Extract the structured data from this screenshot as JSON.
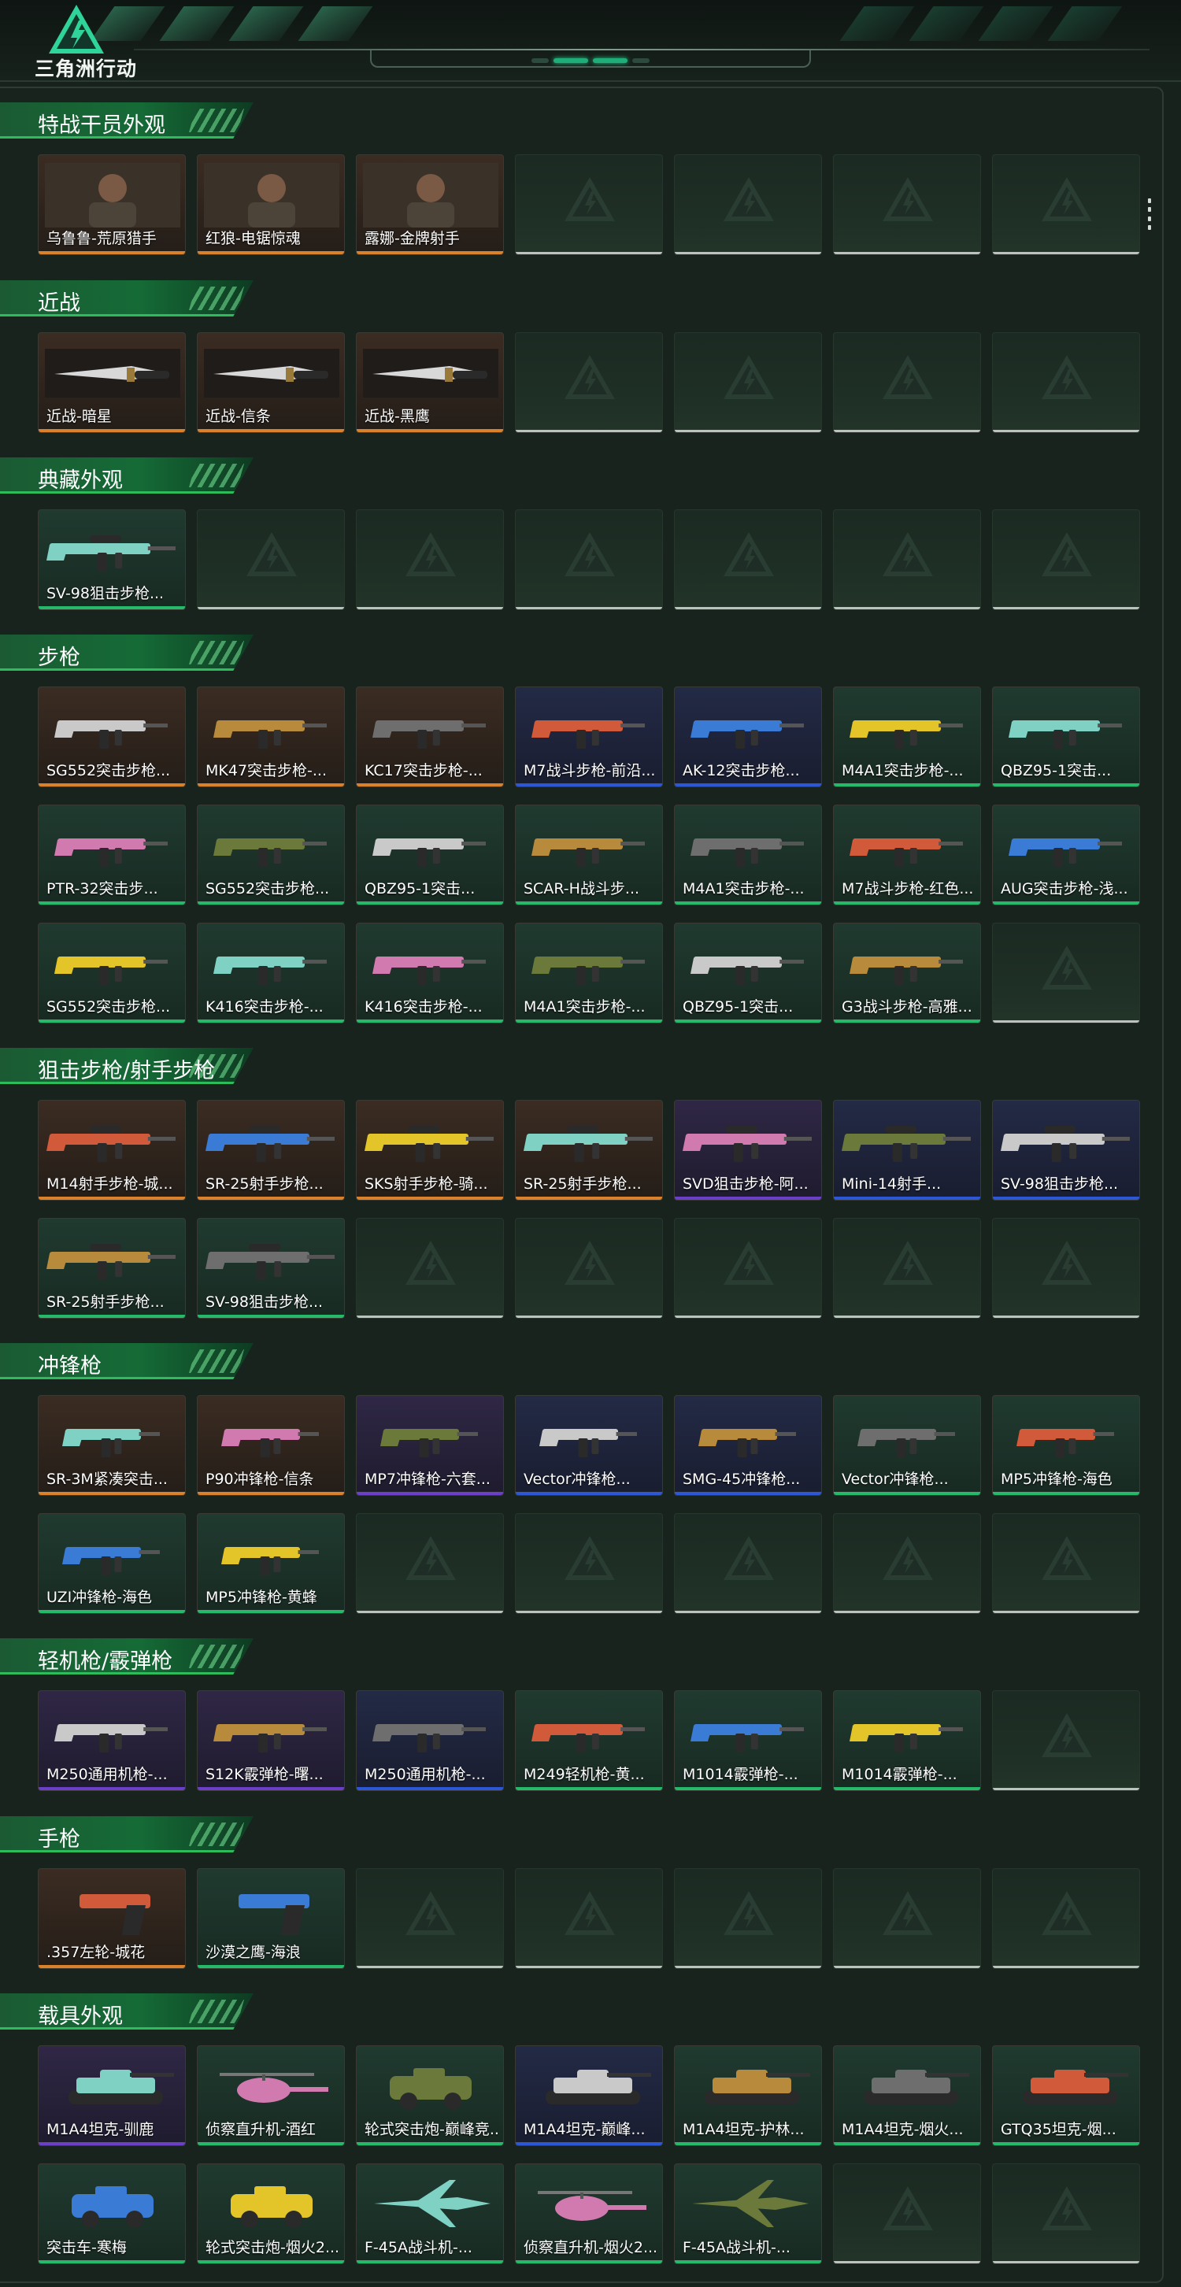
{
  "header": {
    "logo_text": "三角洲行动"
  },
  "colors": {
    "accent": "#1fae7a",
    "section_bar": "#156b36",
    "rarity": {
      "gold": "#d9822b",
      "purple": "#6b3fc8",
      "blue": "#2c58d8",
      "green": "#27b96a",
      "empty": "#bcc3bf"
    }
  },
  "sections": [
    {
      "title": "特战干员外观",
      "items": [
        {
          "name": "乌鲁鲁-荒原猎手",
          "rarity": "gold",
          "icon": "operator-portrait"
        },
        {
          "name": "红狼-电锯惊魂",
          "rarity": "gold",
          "icon": "operator-portrait"
        },
        {
          "name": "露娜-金牌射手",
          "rarity": "gold",
          "icon": "operator-portrait"
        }
      ],
      "slots": 7
    },
    {
      "title": "近战",
      "items": [
        {
          "name": "近战-暗星",
          "rarity": "gold",
          "icon": "knife"
        },
        {
          "name": "近战-信条",
          "rarity": "gold",
          "icon": "knife"
        },
        {
          "name": "近战-黑鹰",
          "rarity": "gold",
          "icon": "knife"
        }
      ],
      "slots": 7
    },
    {
      "title": "典藏外观",
      "items": [
        {
          "name": "SV-98狙击步枪...",
          "rarity": "green",
          "icon": "sniper-rifle"
        }
      ],
      "slots": 7
    },
    {
      "title": "步枪",
      "items": [
        {
          "name": "SG552突击步枪...",
          "rarity": "gold",
          "icon": "rifle"
        },
        {
          "name": "MK47突击步枪-...",
          "rarity": "gold",
          "icon": "rifle"
        },
        {
          "name": "KC17突击步枪-...",
          "rarity": "gold",
          "icon": "rifle"
        },
        {
          "name": "M7战斗步枪-前沿...",
          "rarity": "blue",
          "icon": "rifle"
        },
        {
          "name": "AK-12突击步枪...",
          "rarity": "blue",
          "icon": "rifle"
        },
        {
          "name": "M4A1突击步枪-...",
          "rarity": "green",
          "icon": "rifle"
        },
        {
          "name": "QBZ95-1突击...",
          "rarity": "green",
          "icon": "rifle"
        },
        {
          "name": "PTR-32突击步...",
          "rarity": "green",
          "icon": "rifle"
        },
        {
          "name": "SG552突击步枪...",
          "rarity": "green",
          "icon": "rifle"
        },
        {
          "name": "QBZ95-1突击...",
          "rarity": "green",
          "icon": "rifle"
        },
        {
          "name": "SCAR-H战斗步...",
          "rarity": "green",
          "icon": "rifle"
        },
        {
          "name": "M4A1突击步枪-...",
          "rarity": "green",
          "icon": "rifle"
        },
        {
          "name": "M7战斗步枪-红色...",
          "rarity": "green",
          "icon": "rifle"
        },
        {
          "name": "AUG突击步枪-浅...",
          "rarity": "green",
          "icon": "rifle"
        },
        {
          "name": "SG552突击步枪...",
          "rarity": "green",
          "icon": "rifle"
        },
        {
          "name": "K416突击步枪-...",
          "rarity": "green",
          "icon": "rifle"
        },
        {
          "name": "K416突击步枪-...",
          "rarity": "green",
          "icon": "rifle"
        },
        {
          "name": "M4A1突击步枪-...",
          "rarity": "green",
          "icon": "rifle"
        },
        {
          "name": "QBZ95-1突击...",
          "rarity": "green",
          "icon": "rifle"
        },
        {
          "name": "G3战斗步枪-高雅...",
          "rarity": "green",
          "icon": "rifle"
        }
      ],
      "slots": 21
    },
    {
      "title": "狙击步枪/射手步枪",
      "items": [
        {
          "name": "M14射手步枪-城...",
          "rarity": "gold",
          "icon": "sniper-rifle"
        },
        {
          "name": "SR-25射手步枪...",
          "rarity": "gold",
          "icon": "sniper-rifle"
        },
        {
          "name": "SKS射手步枪-骑...",
          "rarity": "gold",
          "icon": "sniper-rifle"
        },
        {
          "name": "SR-25射手步枪...",
          "rarity": "gold",
          "icon": "sniper-rifle"
        },
        {
          "name": "SVD狙击步枪-阿...",
          "rarity": "purple",
          "icon": "sniper-rifle"
        },
        {
          "name": "Mini-14射手...",
          "rarity": "blue",
          "icon": "sniper-rifle"
        },
        {
          "name": "SV-98狙击步枪...",
          "rarity": "blue",
          "icon": "sniper-rifle"
        },
        {
          "name": "SR-25射手步枪...",
          "rarity": "green",
          "icon": "sniper-rifle"
        },
        {
          "name": "SV-98狙击步枪...",
          "rarity": "green",
          "icon": "sniper-rifle"
        }
      ],
      "slots": 14
    },
    {
      "title": "冲锋枪",
      "items": [
        {
          "name": "SR-3M紧凑突击...",
          "rarity": "gold",
          "icon": "smg"
        },
        {
          "name": "P90冲锋枪-信条",
          "rarity": "gold",
          "icon": "smg"
        },
        {
          "name": "MP7冲锋枪-六套...",
          "rarity": "purple",
          "icon": "smg"
        },
        {
          "name": "Vector冲锋枪...",
          "rarity": "blue",
          "icon": "smg"
        },
        {
          "name": "SMG-45冲锋枪...",
          "rarity": "blue",
          "icon": "smg"
        },
        {
          "name": "Vector冲锋枪...",
          "rarity": "green",
          "icon": "smg"
        },
        {
          "name": "MP5冲锋枪-海色",
          "rarity": "green",
          "icon": "smg"
        },
        {
          "name": "UZI冲锋枪-海色",
          "rarity": "green",
          "icon": "smg"
        },
        {
          "name": "MP5冲锋枪-黄蜂",
          "rarity": "green",
          "icon": "smg"
        }
      ],
      "slots": 14
    },
    {
      "title": "轻机枪/霰弹枪",
      "items": [
        {
          "name": "M250通用机枪-...",
          "rarity": "purple",
          "icon": "machine-gun"
        },
        {
          "name": "S12K霰弹枪-曙...",
          "rarity": "purple",
          "icon": "shotgun"
        },
        {
          "name": "M250通用机枪-...",
          "rarity": "blue",
          "icon": "machine-gun"
        },
        {
          "name": "M249轻机枪-黄...",
          "rarity": "green",
          "icon": "machine-gun"
        },
        {
          "name": "M1014霰弹枪-...",
          "rarity": "green",
          "icon": "shotgun"
        },
        {
          "name": "M1014霰弹枪-...",
          "rarity": "green",
          "icon": "shotgun"
        }
      ],
      "slots": 7
    },
    {
      "title": "手枪",
      "items": [
        {
          "name": ".357左轮-城花",
          "rarity": "gold",
          "icon": "revolver"
        },
        {
          "name": "沙漠之鹰-海浪",
          "rarity": "green",
          "icon": "pistol"
        }
      ],
      "slots": 7
    },
    {
      "title": "载具外观",
      "items": [
        {
          "name": "M1A4坦克-驯鹿",
          "rarity": "purple",
          "icon": "tank"
        },
        {
          "name": "侦察直升机-酒红",
          "rarity": "green",
          "icon": "helicopter"
        },
        {
          "name": "轮式突击炮-巅峰竞...",
          "rarity": "green",
          "icon": "armored-car"
        },
        {
          "name": "M1A4坦克-巅峰...",
          "rarity": "blue",
          "icon": "tank"
        },
        {
          "name": "M1A4坦克-护林...",
          "rarity": "green",
          "icon": "tank"
        },
        {
          "name": "M1A4坦克-烟火...",
          "rarity": "green",
          "icon": "tank"
        },
        {
          "name": "GTQ35坦克-烟...",
          "rarity": "green",
          "icon": "tank"
        },
        {
          "name": "突击车-寒梅",
          "rarity": "green",
          "icon": "assault-vehicle"
        },
        {
          "name": "轮式突击炮-烟火2...",
          "rarity": "green",
          "icon": "armored-car"
        },
        {
          "name": "F-45A战斗机-...",
          "rarity": "green",
          "icon": "jet"
        },
        {
          "name": "侦察直升机-烟火2...",
          "rarity": "green",
          "icon": "helicopter"
        },
        {
          "name": "F-45A战斗机-...",
          "rarity": "green",
          "icon": "jet"
        }
      ],
      "slots": 14
    }
  ]
}
